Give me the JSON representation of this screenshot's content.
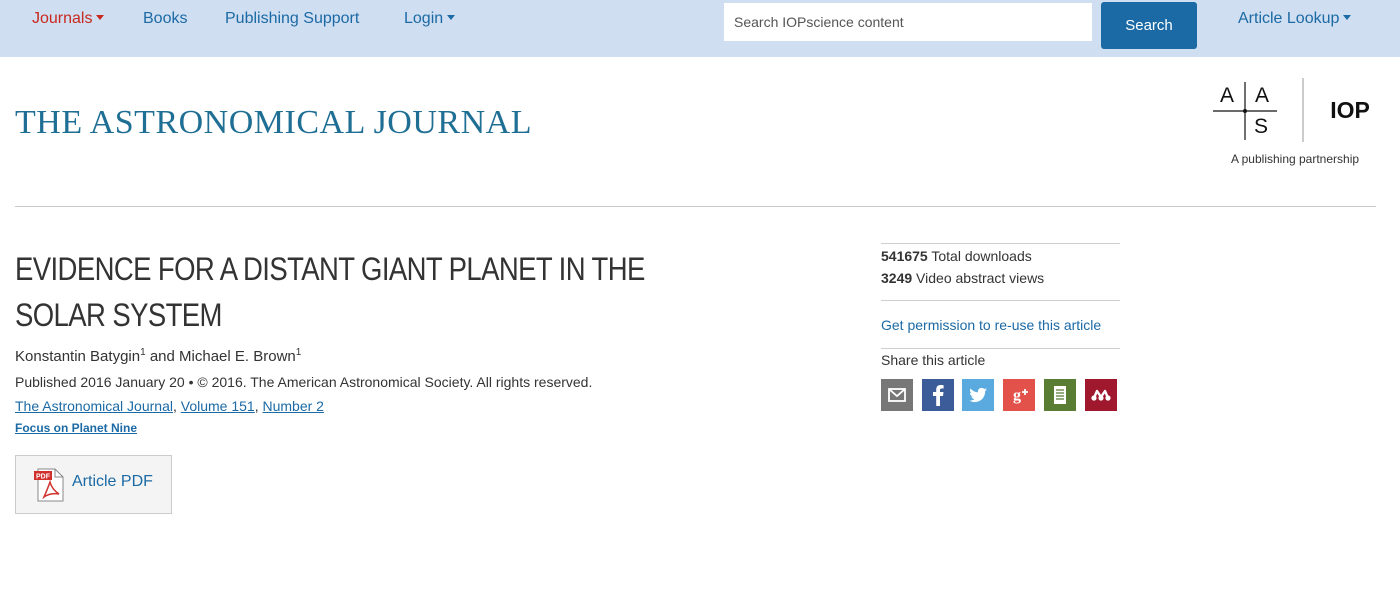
{
  "nav": {
    "journals": "Journals",
    "books": "Books",
    "publishing_support": "Publishing Support",
    "login": "Login",
    "search_placeholder": "Search IOPscience content",
    "search_button": "Search",
    "article_lookup": "Article Lookup"
  },
  "masthead": {
    "journal_title": "THE ASTRONOMICAL JOURNAL",
    "logo_aas_letters": [
      "A",
      "A",
      "S"
    ],
    "logo_iop": "IOP",
    "partnership_caption": "A publishing partnership"
  },
  "article": {
    "title": "EVIDENCE FOR A DISTANT GIANT PLANET IN THE SOLAR SYSTEM",
    "author1": "Konstantin Batygin",
    "author1_aff": "1",
    "author_sep": "and",
    "author2": "Michael E. Brown",
    "author2_aff": "1",
    "published": "Published 2016 January 20",
    "bullet": "•",
    "copyright": "© 2016. The American Astronomical Society. All rights reserved.",
    "journal_link": "The Astronomical Journal",
    "volume_link": "Volume 151",
    "number_link": "Number 2",
    "focus_link": "Focus on Planet Nine",
    "pdf_button": "Article PDF",
    "pdf_badge": "PDF"
  },
  "sidebar": {
    "downloads_count": "541675",
    "downloads_label": "Total downloads",
    "video_count": "3249",
    "video_label": "Video abstract views",
    "permission_link": "Get permission to re-use this article",
    "share_label": "Share this article",
    "share_buttons": [
      {
        "icon": "email-icon",
        "color": "#777777"
      },
      {
        "icon": "facebook-icon",
        "color": "#3b5b99"
      },
      {
        "icon": "twitter-icon",
        "color": "#5aaadf"
      },
      {
        "icon": "google-plus-icon",
        "color": "#e3524a"
      },
      {
        "icon": "citeulike-icon",
        "color": "#5a7d34"
      },
      {
        "icon": "mendeley-icon",
        "color": "#a0182e"
      }
    ]
  },
  "colors": {
    "nav_bg": "#cfdef1",
    "link": "#1b6aa5",
    "active_nav": "#c8281e",
    "journal_title": "#1f6e94"
  }
}
